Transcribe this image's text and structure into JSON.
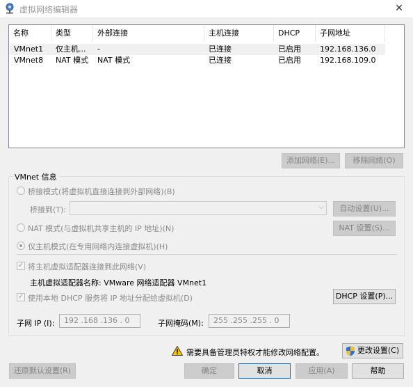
{
  "window": {
    "title": "虚拟网络编辑器"
  },
  "network_table": {
    "headers": [
      "名称",
      "类型",
      "外部连接",
      "主机连接",
      "DHCP",
      "子网地址"
    ],
    "rows": [
      [
        "VMnet1",
        "仅主机...",
        "-",
        "已连接",
        "已启用",
        "192.168.136.0"
      ],
      [
        "VMnet8",
        "NAT 模式",
        "NAT 模式",
        "已连接",
        "已启用",
        "192.168.109.0"
      ]
    ]
  },
  "buttons": {
    "add_network": "添加网络(E)...",
    "remove_network": "移除网络(O)",
    "auto_settings": "自动设置(U)...",
    "nat_settings": "NAT 设置(S)...",
    "dhcp_settings": "DHCP 设置(P)...",
    "change_settings": "更改设置(C)",
    "restore_defaults": "还原默认设置(R)",
    "ok": "确定",
    "cancel": "取消",
    "apply": "应用(A)",
    "help": "帮助"
  },
  "vmnet_info": {
    "group_label": "VMnet 信息",
    "bridged_label": "桥接模式(将虚拟机直接连接到外部网络)(B)",
    "bridged_to_label": "桥接到(T):",
    "bridged_to_value": "",
    "nat_label": "NAT 模式(与虚拟机共享主机的 IP 地址)(N)",
    "host_only_label": "仅主机模式(在专用网络内连接虚拟机)(H)",
    "connect_adapter_label": "将主机虚拟适配器连接到此网络(V)",
    "adapter_name_label": "主机虚拟适配器名称: VMware 网络适配器 VMnet1",
    "use_dhcp_label": "使用本地 DHCP 服务将 IP 地址分配给虚拟机(D)",
    "subnet_ip_label": "子网 IP (I):",
    "subnet_ip_value": "192 .168 .136 .  0",
    "subnet_mask_label": "子网掩码(M):",
    "subnet_mask_value": "255 .255 .255 .  0",
    "selected_mode": "host_only",
    "connect_adapter_checked": true,
    "use_dhcp_checked": true
  },
  "admin_notice": "需要具备管理员特权才能修改网络配置。"
}
